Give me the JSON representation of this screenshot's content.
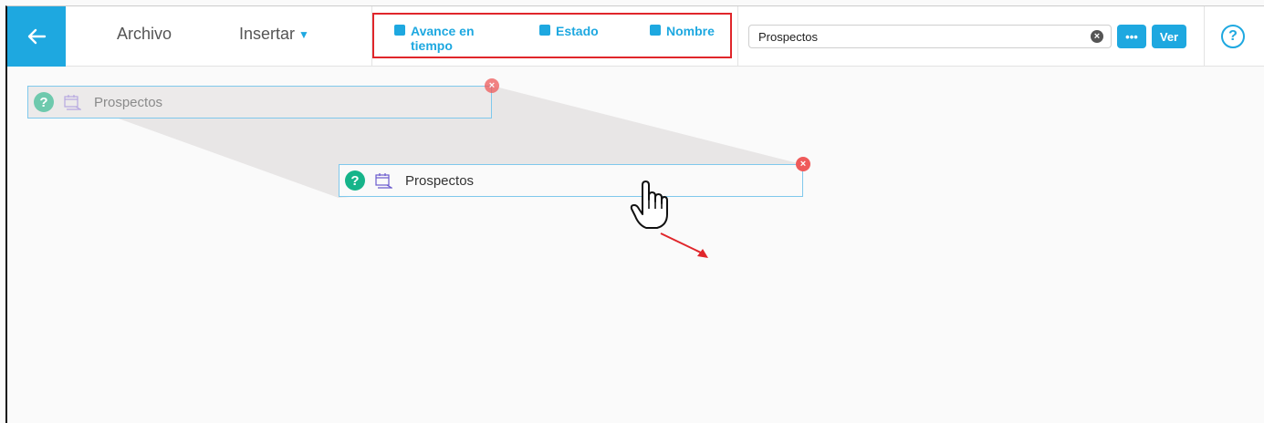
{
  "toolbar": {
    "back_icon": "arrow-left-icon",
    "menu": {
      "archivo": "Archivo",
      "insertar": "Insertar"
    },
    "filters": [
      {
        "label_line1": "Avance en",
        "label_line2": "tiempo"
      },
      {
        "label": "Estado"
      },
      {
        "label": "Nombre"
      }
    ],
    "search": {
      "value": "Prospectos"
    },
    "more_label": "•••",
    "ver_label": "Ver",
    "help_label": "?"
  },
  "canvas": {
    "ghost_card": {
      "label": "Prospectos"
    },
    "live_card": {
      "label": "Prospectos"
    }
  },
  "colors": {
    "accent": "#1ea8e0",
    "highlight": "#e0262b",
    "close": "#ef5a5a",
    "help_green": "#16b48a"
  }
}
